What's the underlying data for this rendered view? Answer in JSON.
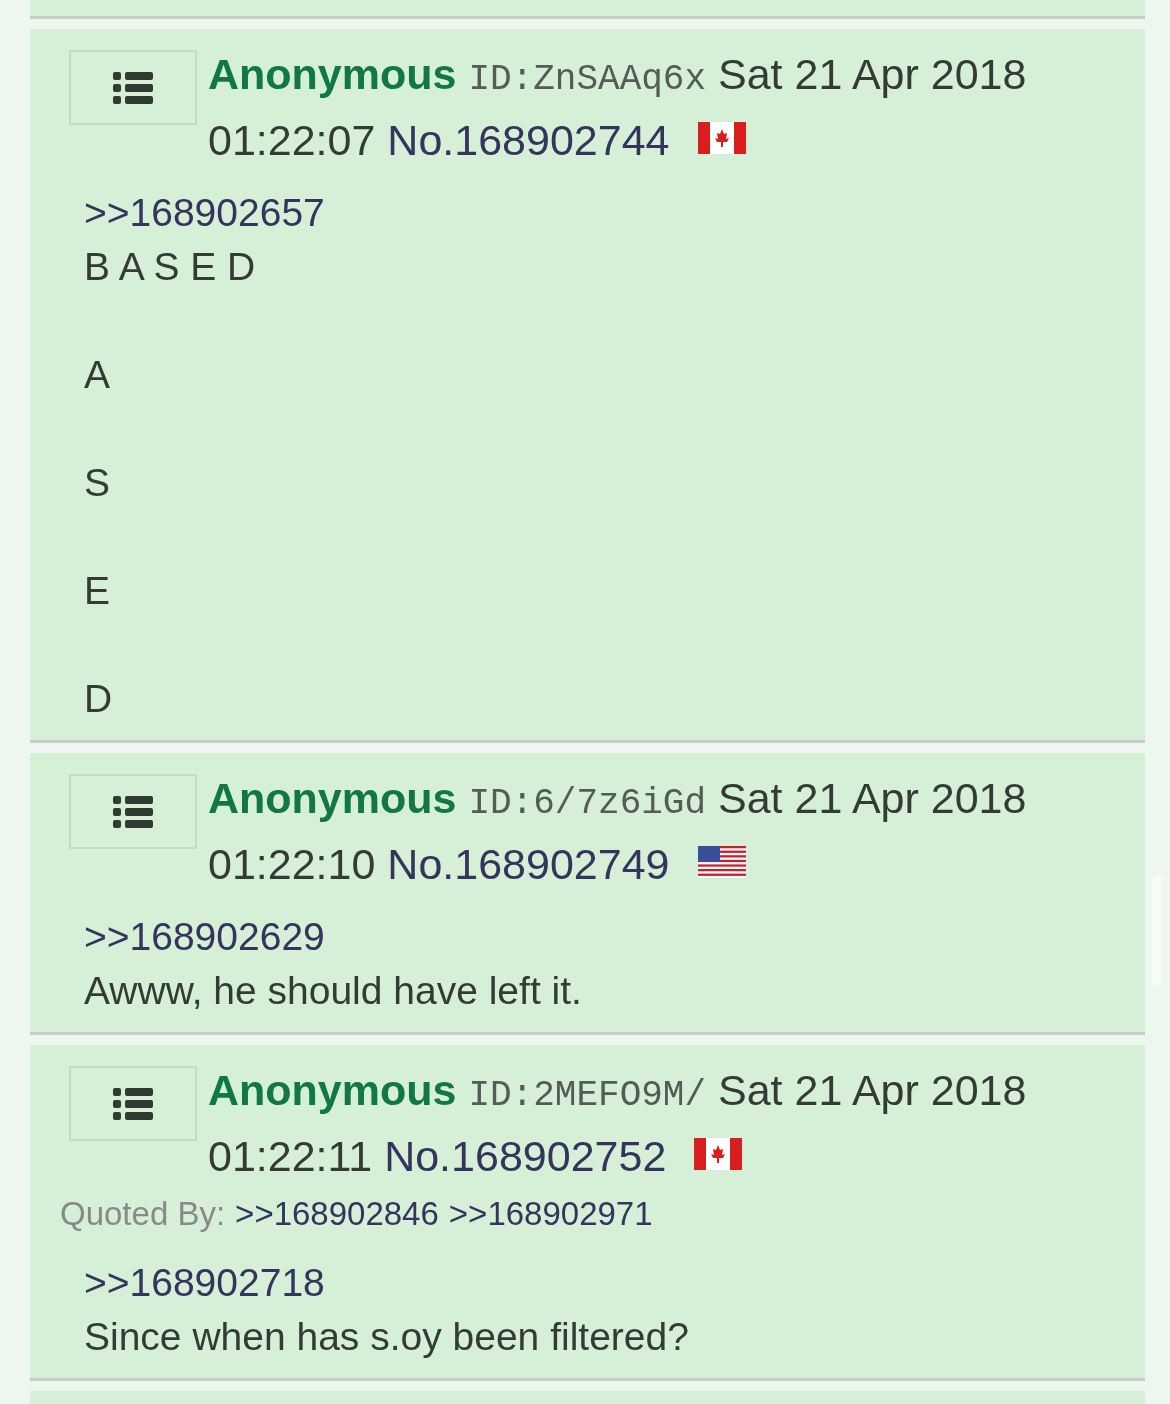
{
  "posts": [
    {
      "name": "Anonymous",
      "id": "ID:ZnSAAq6x",
      "date": "Sat 21 Apr 2018",
      "time": "01:22:07",
      "number": "No.168902744",
      "kind": "canada",
      "quote": ">>168902657",
      "paragraphs": [
        "B A S E D",
        "A",
        "S",
        "E",
        "D"
      ]
    },
    {
      "name": "Anonymous",
      "id": "ID:6/7z6iGd",
      "date": "Sat 21 Apr 2018",
      "time": "01:22:10",
      "number": "No.168902749",
      "kind": "usa",
      "quote": ">>168902629",
      "paragraphs": [
        "Awww, he should have left it."
      ]
    },
    {
      "name": "Anonymous",
      "id": "ID:2MEFO9M/",
      "date": "Sat 21 Apr 2018",
      "time": "01:22:11",
      "number": "No.168902752",
      "kind": "canada",
      "quoted_by": {
        "label": "Quoted By:",
        "links": [
          ">>168902846",
          ">>168902971"
        ]
      },
      "quote": ">>168902718",
      "paragraphs": [
        "Since when has s.oy been filtered?"
      ]
    }
  ]
}
